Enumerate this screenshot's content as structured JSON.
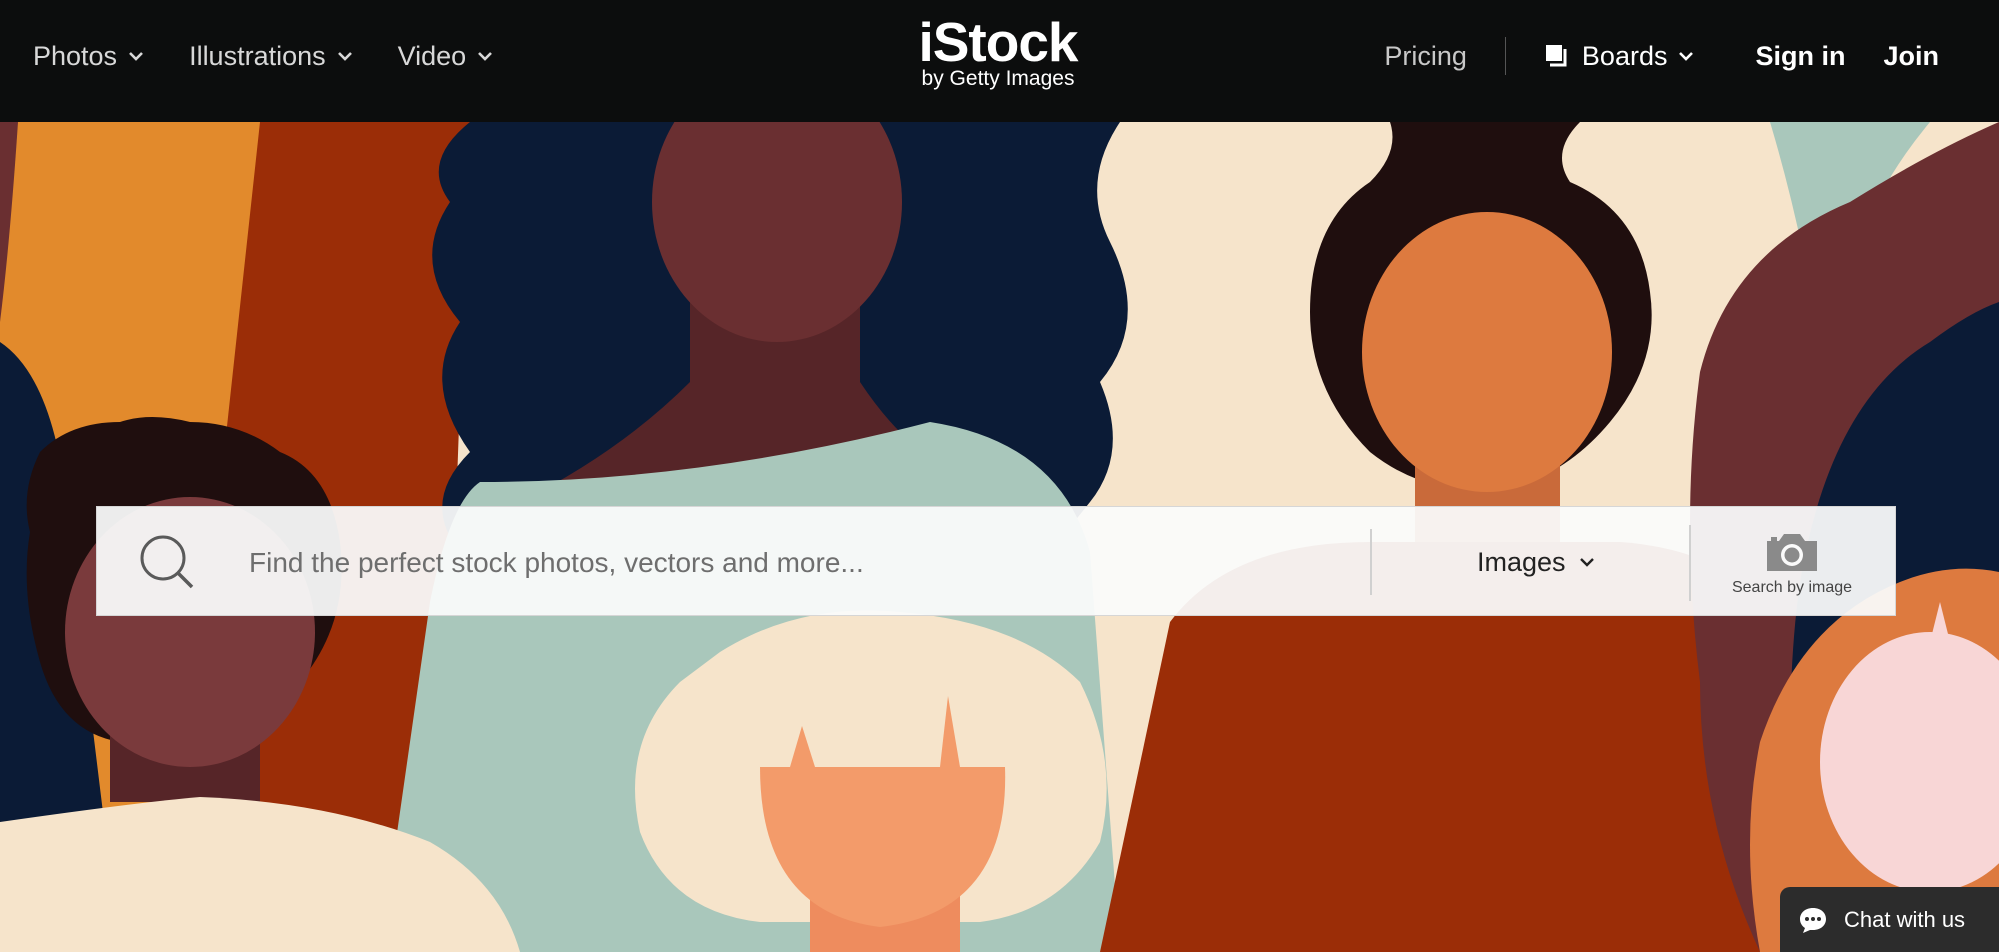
{
  "nav": {
    "left_items": [
      {
        "label": "Photos",
        "icon": "chevron-down-icon"
      },
      {
        "label": "Illustrations",
        "icon": "chevron-down-icon"
      },
      {
        "label": "Video",
        "icon": "chevron-down-icon"
      }
    ],
    "logo": {
      "main": "iStock",
      "sub": "by Getty Images"
    },
    "pricing": "Pricing",
    "boards": "Boards",
    "sign_in": "Sign in",
    "join": "Join"
  },
  "search": {
    "placeholder": "Find the perfect stock photos, vectors and more...",
    "value": "",
    "media_type": "Images",
    "search_by_image": "Search by image"
  },
  "chat": {
    "label": "Chat with us"
  },
  "colors": {
    "nav_bg": "#0c0d0d",
    "navy": "#0b1b36",
    "rust": "#9b2d07",
    "orange": "#e28a2c",
    "cream": "#f6e4cb",
    "sage": "#a9c7bb",
    "maroon": "#6a2f31",
    "dark": "#1f0e0e"
  }
}
